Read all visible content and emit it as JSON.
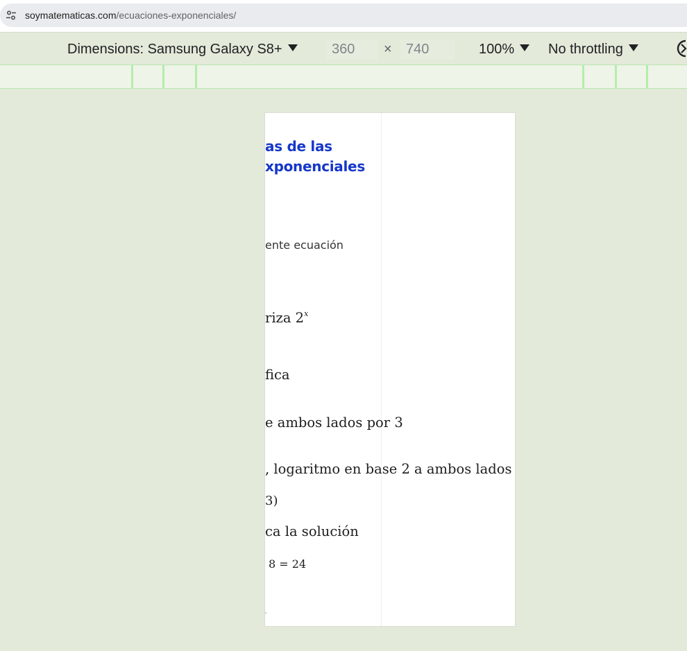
{
  "address_bar": {
    "host": "soymatematicas.com",
    "path": "/ecuaciones-exponenciales/",
    "site_info_icon": "tune-icon"
  },
  "device_toolbar": {
    "dimensions_label": "Dimensions: Samsung Galaxy S8+",
    "width_value": "360",
    "times": "×",
    "height_value": "740",
    "zoom": "100%",
    "throttling": "No throttling",
    "rotate_icon": "rotate-icon"
  },
  "page": {
    "heading_line1": "as de las",
    "heading_line2": "xponenciales",
    "intro": "ente ecuación",
    "step1_text": "riza 2",
    "step1_exp": "x",
    "step2_text": "fica",
    "step3_text": "e ambos lados por 3",
    "step4_text": ", logaritmo en base 2 a ambos lados",
    "step4_tail": "3)",
    "step5_text": "ca la solución",
    "check": "8 = 24"
  },
  "colors": {
    "background": "#e3ead9",
    "heading": "#1537c9",
    "media_query_bar": "#eef4e8"
  }
}
